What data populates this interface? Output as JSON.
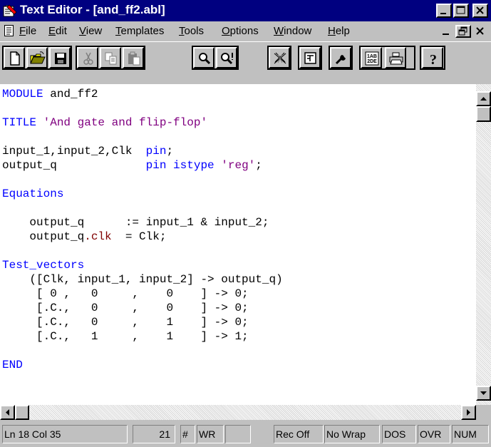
{
  "window": {
    "title": "Text Editor - [and_ff2.abl]",
    "caption_buttons": [
      "minimize-icon",
      "maximize-icon",
      "close-icon"
    ]
  },
  "menubar": {
    "items": [
      {
        "label": "File",
        "accel": "F",
        "rest": "ile"
      },
      {
        "label": "Edit",
        "accel": "E",
        "rest": "dit"
      },
      {
        "label": "View",
        "accel": "V",
        "rest": "iew"
      },
      {
        "label": "Templates",
        "accel": "T",
        "rest": "emplates"
      },
      {
        "label": "Tools",
        "accel": "T",
        "rest": "ools"
      },
      {
        "label": "Options",
        "accel": "O",
        "rest": "ptions"
      },
      {
        "label": "Window",
        "accel": "W",
        "rest": "indow"
      },
      {
        "label": "Help",
        "accel": "H",
        "rest": "elp"
      }
    ],
    "doc_buttons": [
      "minimize-icon",
      "restore-icon",
      "close-icon"
    ]
  },
  "toolbar": {
    "buttons": [
      "new-file-icon",
      "open-folder-icon",
      "save-disk-icon",
      "cut-scissors-icon",
      "copy-icon",
      "paste-icon",
      "find-icon",
      "find-next-icon",
      "clear-icon",
      "template-icon",
      "wrench-icon",
      "spelling-icon",
      "print-icon",
      "help-icon"
    ]
  },
  "editor": {
    "lines": [
      {
        "segs": [
          {
            "t": "MODULE",
            "c": "blue"
          },
          {
            "t": " and_ff2",
            "c": "dark"
          }
        ]
      },
      {
        "segs": [
          {
            "t": "",
            "c": "dark"
          }
        ]
      },
      {
        "segs": [
          {
            "t": "TITLE",
            "c": "blue"
          },
          {
            "t": " 'And gate and flip-flop'",
            "c": "purple"
          }
        ]
      },
      {
        "segs": [
          {
            "t": "",
            "c": "dark"
          }
        ]
      },
      {
        "segs": [
          {
            "t": "input_1,input_2,Clk  ",
            "c": "dark"
          },
          {
            "t": "pin",
            "c": "blue"
          },
          {
            "t": ";",
            "c": "dark"
          }
        ]
      },
      {
        "segs": [
          {
            "t": "output_q             ",
            "c": "dark"
          },
          {
            "t": "pin istype",
            "c": "blue"
          },
          {
            "t": " 'reg'",
            "c": "purple"
          },
          {
            "t": ";",
            "c": "dark"
          }
        ]
      },
      {
        "segs": [
          {
            "t": "",
            "c": "dark"
          }
        ]
      },
      {
        "segs": [
          {
            "t": "Equations",
            "c": "blue"
          }
        ]
      },
      {
        "segs": [
          {
            "t": "",
            "c": "dark"
          }
        ]
      },
      {
        "segs": [
          {
            "t": "    output_q      := input_1 & input_2;",
            "c": "dark"
          }
        ]
      },
      {
        "segs": [
          {
            "t": "    output_q",
            "c": "dark"
          },
          {
            "t": ".clk",
            "c": "maroon"
          },
          {
            "t": "  = Clk;",
            "c": "dark"
          }
        ]
      },
      {
        "segs": [
          {
            "t": "",
            "c": "dark"
          }
        ]
      },
      {
        "segs": [
          {
            "t": "Test_vectors",
            "c": "blue"
          }
        ]
      },
      {
        "segs": [
          {
            "t": "    ([Clk, input_1, input_2] -> output_q)",
            "c": "dark"
          }
        ]
      },
      {
        "segs": [
          {
            "t": "     [ 0 ,   0     ,    0    ] -> 0;",
            "c": "dark"
          }
        ]
      },
      {
        "segs": [
          {
            "t": "     [.C.,   0     ,    0    ] -> 0;",
            "c": "dark"
          }
        ]
      },
      {
        "segs": [
          {
            "t": "     [.C.,   0     ,    1    ] -> 0;",
            "c": "dark"
          }
        ]
      },
      {
        "segs": [
          {
            "t": "     [.C.,   1     ,    1    ] -> 1;",
            "c": "dark"
          }
        ]
      },
      {
        "segs": [
          {
            "t": "",
            "c": "dark"
          }
        ]
      },
      {
        "segs": [
          {
            "t": "END",
            "c": "blue"
          }
        ]
      }
    ]
  },
  "statusbar": {
    "position": "Ln 18 Col 35",
    "line_count": "21",
    "hash": "#",
    "wr": "WR",
    "blank": "",
    "rec": "Rec Off",
    "wrap": "No Wrap",
    "dos": "DOS",
    "ovr": "OVR",
    "num": "NUM"
  },
  "colors": {
    "titlebar": "#000080",
    "keyword": "#0000ff",
    "string": "#800080",
    "property": "#800000",
    "chrome": "#c0c0c0"
  }
}
